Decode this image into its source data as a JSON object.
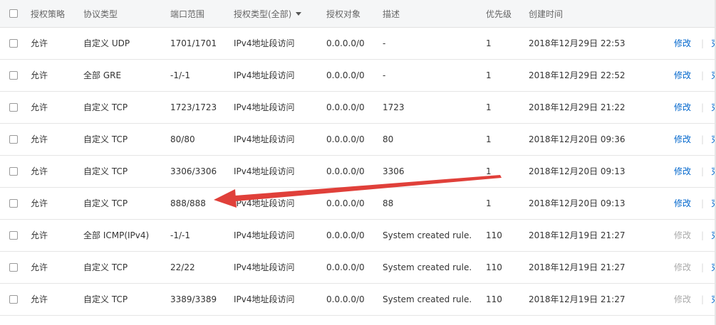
{
  "header": {
    "col_policy": "授权策略",
    "col_protocol": "协议类型",
    "col_port": "端口范围",
    "col_auth_type": "授权类型(全部)",
    "col_auth_target": "授权对象",
    "col_desc": "描述",
    "col_priority": "优先级",
    "col_created": "创建时间"
  },
  "rows": [
    {
      "policy": "允许",
      "protocol": "自定义 UDP",
      "port": "1701/1701",
      "auth_type": "IPv4地址段访问",
      "target": "0.0.0.0/0",
      "desc": "-",
      "priority": "1",
      "created": "2018年12月29日 22:53",
      "modify": "修改",
      "extra": "克",
      "modify_enabled": true
    },
    {
      "policy": "允许",
      "protocol": "全部 GRE",
      "port": "-1/-1",
      "auth_type": "IPv4地址段访问",
      "target": "0.0.0.0/0",
      "desc": "-",
      "priority": "1",
      "created": "2018年12月29日 22:52",
      "modify": "修改",
      "extra": "克",
      "modify_enabled": true
    },
    {
      "policy": "允许",
      "protocol": "自定义 TCP",
      "port": "1723/1723",
      "auth_type": "IPv4地址段访问",
      "target": "0.0.0.0/0",
      "desc": "1723",
      "priority": "1",
      "created": "2018年12月29日 21:22",
      "modify": "修改",
      "extra": "克",
      "modify_enabled": true
    },
    {
      "policy": "允许",
      "protocol": "自定义 TCP",
      "port": "80/80",
      "auth_type": "IPv4地址段访问",
      "target": "0.0.0.0/0",
      "desc": "80",
      "priority": "1",
      "created": "2018年12月20日 09:36",
      "modify": "修改",
      "extra": "克",
      "modify_enabled": true
    },
    {
      "policy": "允许",
      "protocol": "自定义 TCP",
      "port": "3306/3306",
      "auth_type": "IPv4地址段访问",
      "target": "0.0.0.0/0",
      "desc": "3306",
      "priority": "1",
      "created": "2018年12月20日 09:13",
      "modify": "修改",
      "extra": "克",
      "modify_enabled": true
    },
    {
      "policy": "允许",
      "protocol": "自定义 TCP",
      "port": "888/888",
      "auth_type": "IPv4地址段访问",
      "target": "0.0.0.0/0",
      "desc": "88",
      "priority": "1",
      "created": "2018年12月20日 09:13",
      "modify": "修改",
      "extra": "克",
      "modify_enabled": true
    },
    {
      "policy": "允许",
      "protocol": "全部 ICMP(IPv4)",
      "port": "-1/-1",
      "auth_type": "IPv4地址段访问",
      "target": "0.0.0.0/0",
      "desc": "System created rule.",
      "priority": "110",
      "created": "2018年12月19日 21:27",
      "modify": "修改",
      "extra": "克",
      "modify_enabled": false
    },
    {
      "policy": "允许",
      "protocol": "自定义 TCP",
      "port": "22/22",
      "auth_type": "IPv4地址段访问",
      "target": "0.0.0.0/0",
      "desc": "System created rule.",
      "priority": "110",
      "created": "2018年12月19日 21:27",
      "modify": "修改",
      "extra": "克",
      "modify_enabled": false
    },
    {
      "policy": "允许",
      "protocol": "自定义 TCP",
      "port": "3389/3389",
      "auth_type": "IPv4地址段访问",
      "target": "0.0.0.0/0",
      "desc": "System created rule.",
      "priority": "110",
      "created": "2018年12月19日 21:27",
      "modify": "修改",
      "extra": "克",
      "modify_enabled": false
    }
  ],
  "colors": {
    "link": "#0066cc",
    "link_disabled": "#aaaaaa",
    "annotation_arrow": "#e0403a",
    "header_bg": "#f5f6f7"
  }
}
